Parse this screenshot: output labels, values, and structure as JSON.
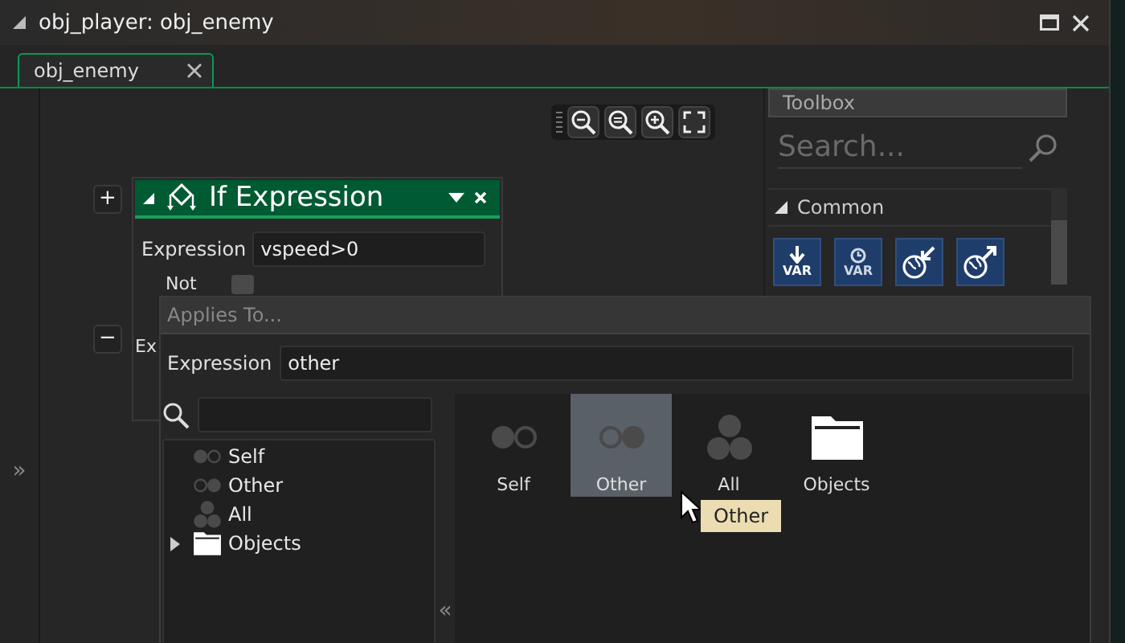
{
  "window": {
    "title": "obj_player: obj_enemy"
  },
  "tabs": [
    {
      "label": "obj_enemy",
      "selected": true
    }
  ],
  "side_glyph": "»",
  "node_buttons": [
    "+",
    "−"
  ],
  "node": {
    "title": "If Expression",
    "expression_label": "Expression",
    "expression_value": "vspeed>0",
    "not_label": "Not",
    "not_checked": false,
    "cut_label": "Ex"
  },
  "toolbox": {
    "title": "Toolbox",
    "search": {
      "placeholder": "Search..."
    },
    "section": {
      "label": "Common",
      "expanded": true
    },
    "actions": [
      {
        "kind": "var-arrow",
        "label": "VAR"
      },
      {
        "kind": "var-clock",
        "label": "VAR"
      },
      {
        "kind": "globe-in"
      },
      {
        "kind": "globe-out"
      }
    ]
  },
  "dialog": {
    "title": "Applies To...",
    "expression_label": "Expression",
    "expression_value": "other",
    "tree": [
      {
        "label": "Self",
        "kind": "self"
      },
      {
        "label": "Other",
        "kind": "other"
      },
      {
        "label": "All",
        "kind": "all"
      },
      {
        "label": "Objects",
        "kind": "folder",
        "expanded": false
      }
    ],
    "collapse_glyph": "«",
    "grid": [
      {
        "label": "Self",
        "kind": "self",
        "selected": false
      },
      {
        "label": "Other",
        "kind": "other",
        "selected": true
      },
      {
        "label": "All",
        "kind": "all",
        "selected": false
      },
      {
        "label": "Objects",
        "kind": "folder",
        "selected": false
      }
    ],
    "tooltip": "Other"
  }
}
